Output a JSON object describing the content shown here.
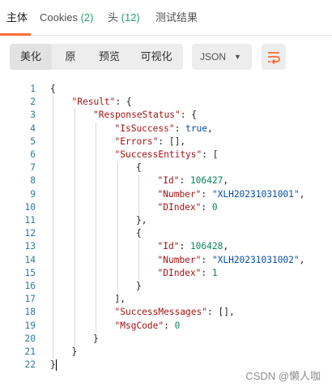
{
  "tabs": [
    {
      "label": "主体",
      "count": ""
    },
    {
      "label": "Cookies",
      "count": "(2)"
    },
    {
      "label": "头",
      "count": "(12)"
    },
    {
      "label": "测试结果",
      "count": ""
    }
  ],
  "toolbar": {
    "views": [
      "美化",
      "原",
      "预览",
      "可视化"
    ],
    "format": "JSON",
    "format_caret_icon": "chevron-down-icon",
    "wrap_icon": "wrap-lines-icon",
    "accent_color": "#ff6c37"
  },
  "editor": {
    "line_numbers": [
      "1",
      "2",
      "3",
      "4",
      "5",
      "6",
      "7",
      "8",
      "9",
      "10",
      "11",
      "12",
      "13",
      "14",
      "15",
      "16",
      "17",
      "18",
      "19",
      "20",
      "21",
      "22"
    ],
    "lines": [
      [
        {
          "t": "p",
          "v": "{"
        }
      ],
      [
        {
          "t": "k",
          "v": "\"Result\""
        },
        {
          "t": "p",
          "v": ": {"
        }
      ],
      [
        {
          "t": "k",
          "v": "\"ResponseStatus\""
        },
        {
          "t": "p",
          "v": ": {"
        }
      ],
      [
        {
          "t": "k",
          "v": "\"IsSuccess\""
        },
        {
          "t": "p",
          "v": ": "
        },
        {
          "t": "l",
          "v": "true"
        },
        {
          "t": "p",
          "v": ","
        }
      ],
      [
        {
          "t": "k",
          "v": "\"Errors\""
        },
        {
          "t": "p",
          "v": ": [],"
        }
      ],
      [
        {
          "t": "k",
          "v": "\"SuccessEntitys\""
        },
        {
          "t": "p",
          "v": ": ["
        }
      ],
      [
        {
          "t": "p",
          "v": "{"
        }
      ],
      [
        {
          "t": "k",
          "v": "\"Id\""
        },
        {
          "t": "p",
          "v": ": "
        },
        {
          "t": "n",
          "v": "106427"
        },
        {
          "t": "p",
          "v": ","
        }
      ],
      [
        {
          "t": "k",
          "v": "\"Number\""
        },
        {
          "t": "p",
          "v": ": "
        },
        {
          "t": "s",
          "v": "\"XLH20231031001\""
        },
        {
          "t": "p",
          "v": ","
        }
      ],
      [
        {
          "t": "k",
          "v": "\"DIndex\""
        },
        {
          "t": "p",
          "v": ": "
        },
        {
          "t": "n",
          "v": "0"
        }
      ],
      [
        {
          "t": "p",
          "v": "},"
        }
      ],
      [
        {
          "t": "p",
          "v": "{"
        }
      ],
      [
        {
          "t": "k",
          "v": "\"Id\""
        },
        {
          "t": "p",
          "v": ": "
        },
        {
          "t": "n",
          "v": "106428"
        },
        {
          "t": "p",
          "v": ","
        }
      ],
      [
        {
          "t": "k",
          "v": "\"Number\""
        },
        {
          "t": "p",
          "v": ": "
        },
        {
          "t": "s",
          "v": "\"XLH20231031002\""
        },
        {
          "t": "p",
          "v": ","
        }
      ],
      [
        {
          "t": "k",
          "v": "\"DIndex\""
        },
        {
          "t": "p",
          "v": ": "
        },
        {
          "t": "n",
          "v": "1"
        }
      ],
      [
        {
          "t": "p",
          "v": "}"
        }
      ],
      [
        {
          "t": "p",
          "v": "],"
        }
      ],
      [
        {
          "t": "k",
          "v": "\"SuccessMessages\""
        },
        {
          "t": "p",
          "v": ": [],"
        }
      ],
      [
        {
          "t": "k",
          "v": "\"MsgCode\""
        },
        {
          "t": "p",
          "v": ": "
        },
        {
          "t": "n",
          "v": "0"
        }
      ],
      [
        {
          "t": "p",
          "v": "}"
        }
      ],
      [
        {
          "t": "p",
          "v": "}"
        }
      ],
      [
        {
          "t": "p",
          "v": "}"
        }
      ]
    ],
    "indent_levels": [
      0,
      1,
      2,
      3,
      3,
      3,
      4,
      5,
      5,
      5,
      4,
      4,
      5,
      5,
      5,
      4,
      3,
      3,
      3,
      2,
      1,
      0
    ]
  },
  "watermark": "CSDN @懒人咖"
}
